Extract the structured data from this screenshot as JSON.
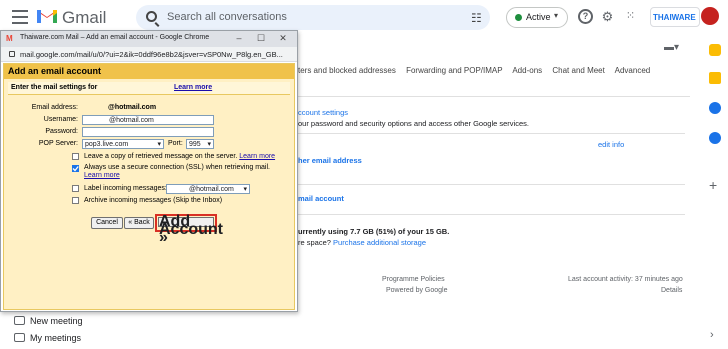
{
  "header": {
    "app_name": "Gmail",
    "search_placeholder": "Search all conversations",
    "status": "Active",
    "brand_label": "THAIWARE"
  },
  "settings": {
    "tabs": [
      "ters and blocked addresses",
      "Forwarding and POP/IMAP",
      "Add-ons",
      "Chat and Meet",
      "Advanced"
    ],
    "account_settings_link": "ccount settings",
    "account_settings_desc": "our password and security options and access other Google services.",
    "other_email": "her email address",
    "edit_info": "edit info",
    "mail_account": "mail account",
    "storage_line": "urrently using 7.7 GB (51%) of your 15 GB.",
    "more_space": "re space?",
    "purchase_link": "Purchase additional storage",
    "programme_policies": "Programme Policies",
    "powered_by": "Powered by Google",
    "last_activity": "Last account activity: 37 minutes ago",
    "details": "Details"
  },
  "meet": {
    "new_meeting": "New meeting",
    "my_meetings": "My meetings"
  },
  "popup": {
    "window_title": "Thaiware.com Mail – Add an email account - Google Chrome",
    "url": "mail.google.com/mail/u/0/?ui=2&ik=0ddf96e8b2&jsver=vSP0Nw_P8lg.en_GB...",
    "heading": "Add an email account",
    "subheading": "Enter the mail settings for",
    "learn_more": "Learn more",
    "email_label": "Email address:",
    "email_value": "@hotmail.com",
    "username_label": "Username:",
    "username_value": "@hotmail.com",
    "password_label": "Password:",
    "pop_label": "POP Server:",
    "pop_value": "pop3.live.com",
    "port_label": "Port:",
    "port_value": "995",
    "opt1": "Leave a copy of retrieved message on the server.",
    "opt1_link": "Learn more",
    "opt2": "Always use a secure connection (SSL) when retrieving mail.",
    "opt2_link": "Learn more",
    "opt3": "Label incoming messages:",
    "opt3_value": "@hotmail.com",
    "opt4": "Archive incoming messages (Skip the Inbox)",
    "cancel": "Cancel",
    "back": "« Back",
    "add_account": "Add Account »",
    "checks": {
      "opt1": false,
      "opt2": true,
      "opt3": false,
      "opt4": false
    }
  },
  "colors": {
    "accent": "#1a73e8",
    "highlight": "#d93025",
    "dialog_bg": "#fff0c4",
    "dialog_header": "#f0c24a"
  }
}
